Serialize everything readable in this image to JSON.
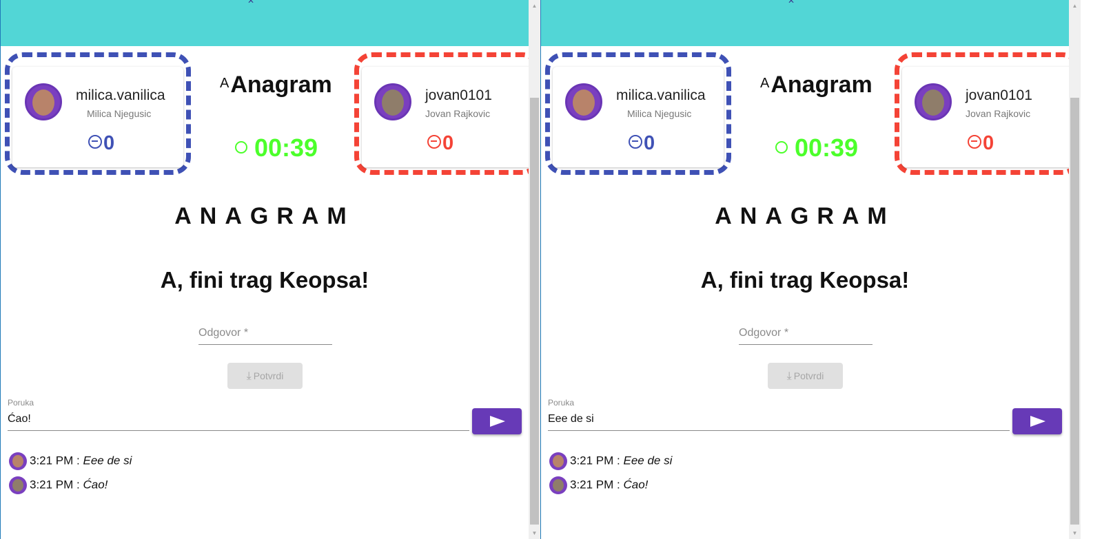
{
  "windows": [
    {
      "player_left": {
        "username": "milica.vanilica",
        "fullname": "Milica Njegusic",
        "score": "0"
      },
      "player_right": {
        "username": "jovan0101",
        "fullname": "Jovan Rajkovic",
        "score": "0"
      },
      "logo": "Anagram",
      "timer": "00:39",
      "game_title": "ANAGRAM",
      "puzzle": "A, fini trag Keopsa!",
      "answer_placeholder": "Odgovor *",
      "confirm_label": "Potvrdi",
      "message_label": "Poruka",
      "message_value": "Ćao!",
      "chat": [
        {
          "time": "3:21 PM :",
          "text": "Eee de si"
        },
        {
          "time": "3:21 PM :",
          "text": "Ćao!"
        }
      ]
    },
    {
      "player_left": {
        "username": "milica.vanilica",
        "fullname": "Milica Njegusic",
        "score": "0"
      },
      "player_right": {
        "username": "jovan0101",
        "fullname": "Jovan Rajkovic",
        "score": "0"
      },
      "logo": "Anagram",
      "timer": "00:39",
      "game_title": "ANAGRAM",
      "puzzle": "A, fini trag Keopsa!",
      "answer_placeholder": "Odgovor *",
      "confirm_label": "Potvrdi",
      "message_label": "Poruka",
      "message_value": "Eee de si",
      "chat": [
        {
          "time": "3:21 PM :",
          "text": "Eee de si"
        },
        {
          "time": "3:21 PM :",
          "text": "Ćao!"
        }
      ]
    }
  ],
  "colors": {
    "header": "#52d6d6",
    "blue_player": "#3f51b5",
    "red_player": "#f44336",
    "timer": "#4cff2b",
    "send_button": "#673ab7"
  }
}
